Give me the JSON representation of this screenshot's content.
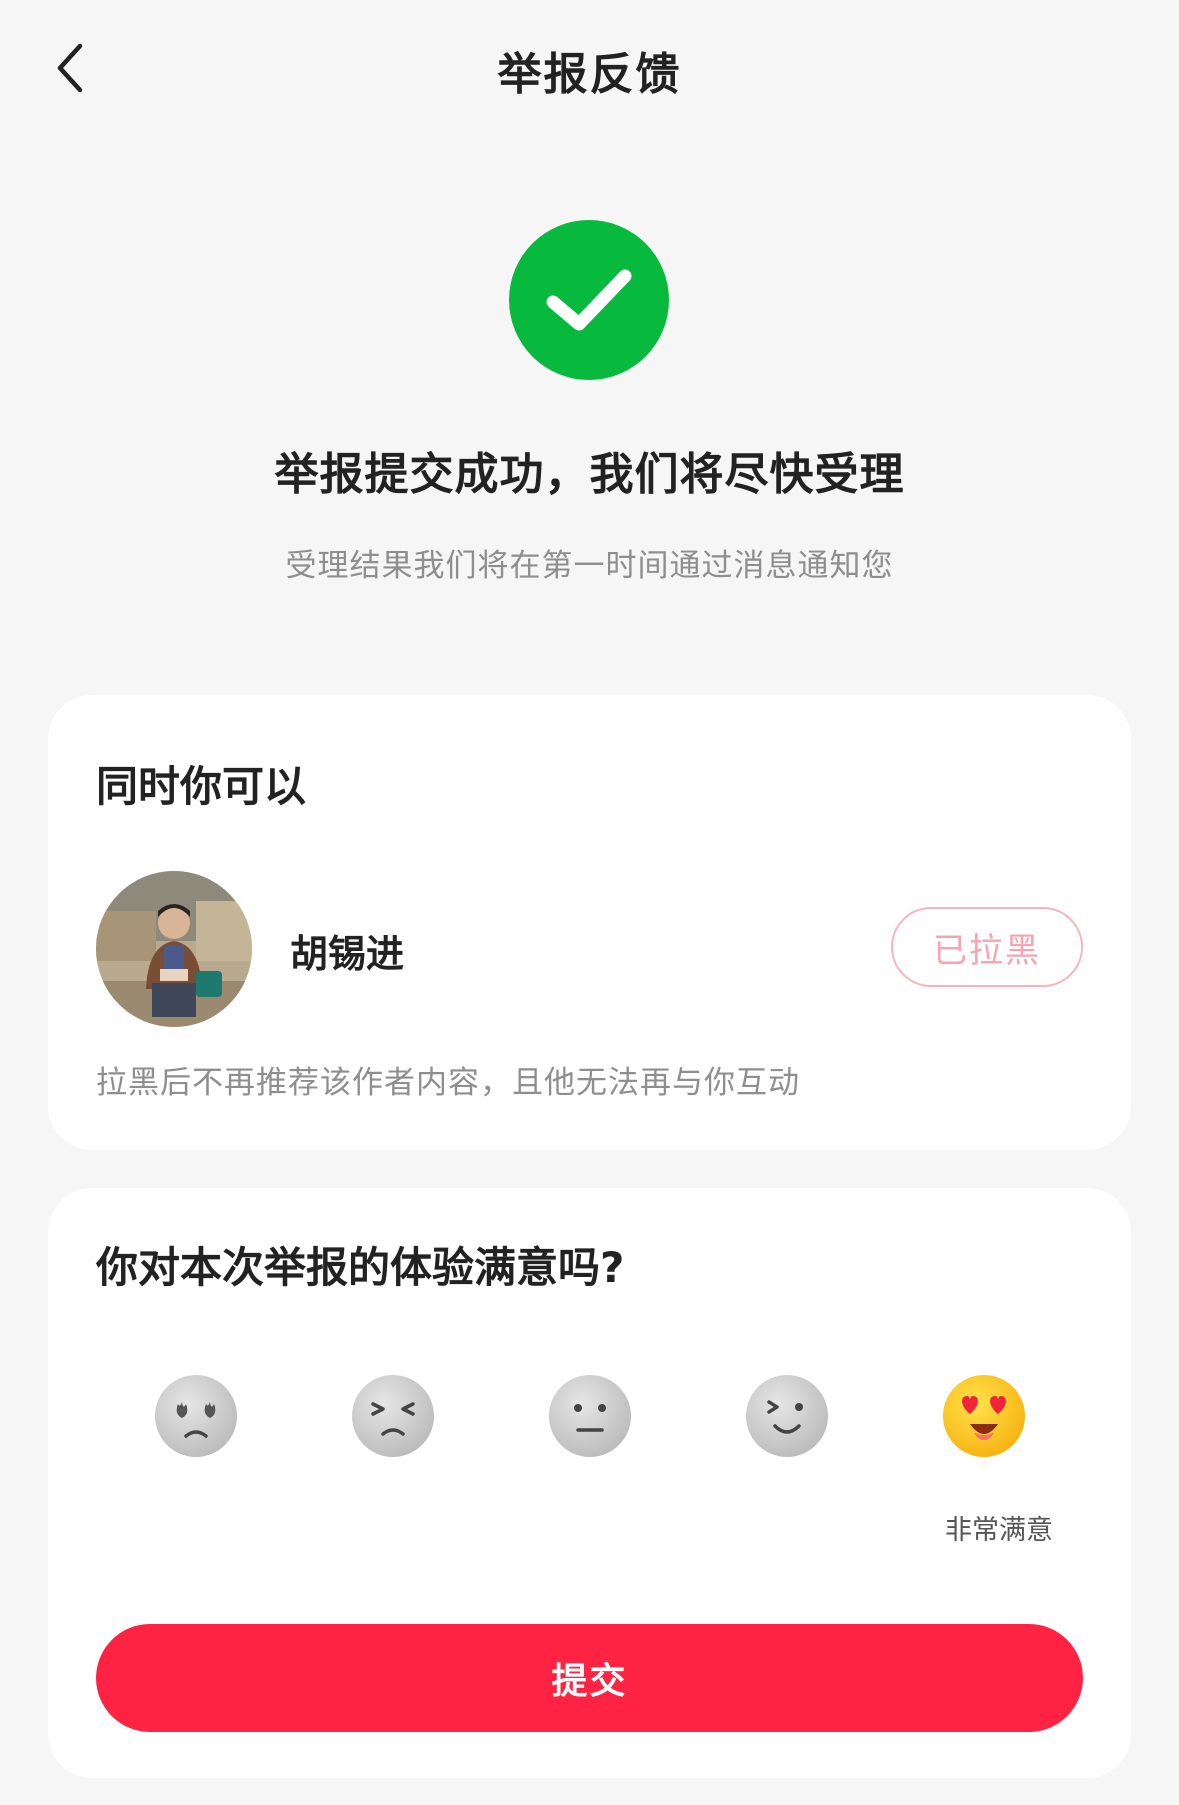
{
  "header": {
    "title": "举报反馈",
    "back_icon": "chevron-left-icon"
  },
  "success": {
    "icon": "check-circle-icon",
    "icon_color": "#07b93d",
    "title": "举报提交成功，我们将尽快受理",
    "subtitle": "受理结果我们将在第一时间通过消息通知您"
  },
  "actions_card": {
    "title": "同时你可以",
    "user": {
      "name": "胡锡进"
    },
    "blocked_button_label": "已拉黑",
    "hint": "拉黑后不再推荐该作者内容，且他无法再与你互动"
  },
  "feedback_card": {
    "title": "你对本次举报的体验满意吗?",
    "ratings": [
      "very-dissatisfied",
      "dissatisfied",
      "neutral",
      "satisfied",
      "very-satisfied"
    ],
    "selected_label": "非常满意",
    "submit_label": "提交",
    "accent_color": "#fe2342"
  }
}
